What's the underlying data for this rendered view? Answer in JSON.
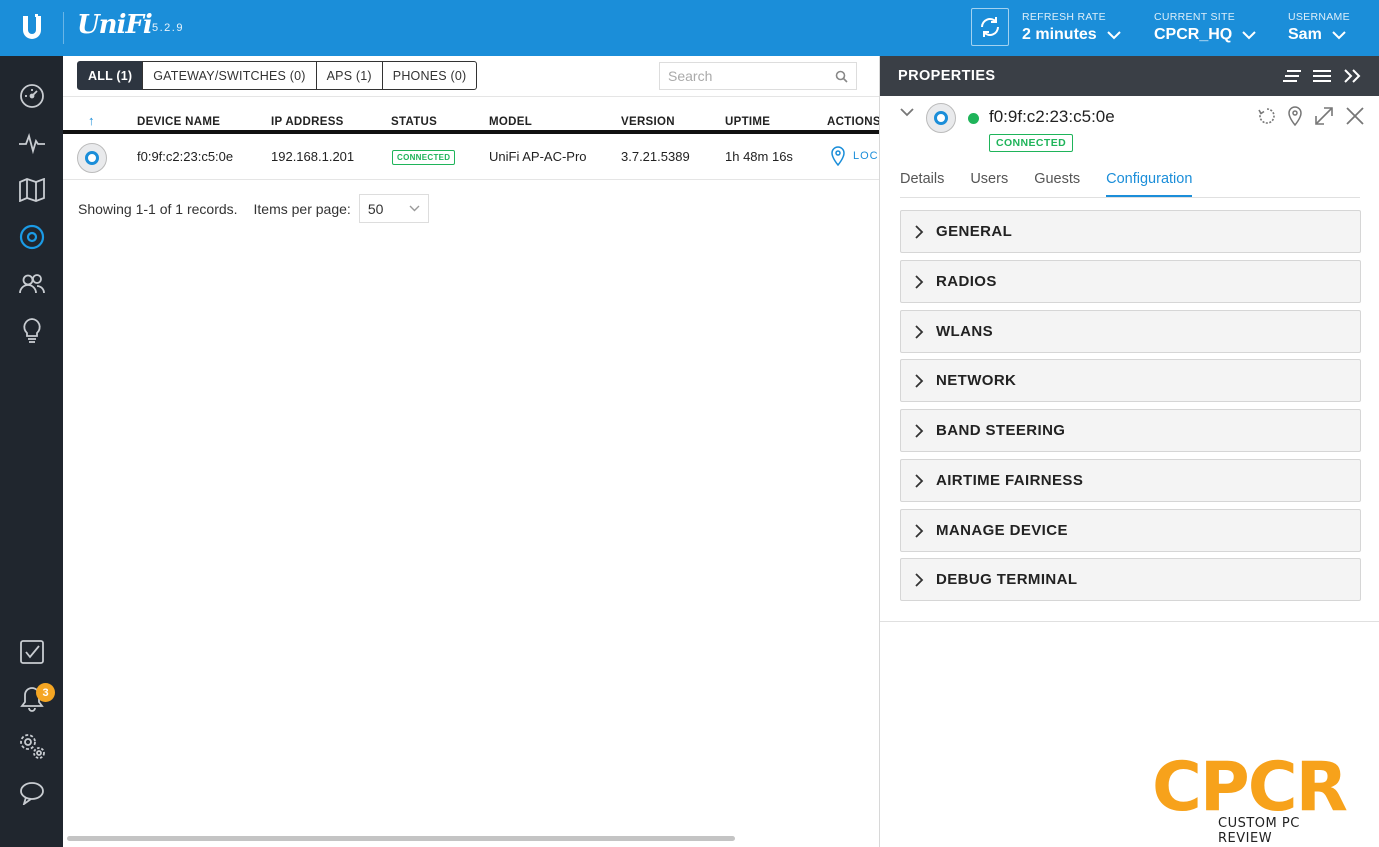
{
  "header": {
    "brand": "UniFi",
    "version": "5.2.9",
    "refresh_rate": {
      "label": "REFRESH RATE",
      "value": "2 minutes"
    },
    "current_site": {
      "label": "CURRENT SITE",
      "value": "CPCR_HQ"
    },
    "username": {
      "label": "USERNAME",
      "value": "Sam"
    }
  },
  "sidebar": {
    "items": [
      {
        "icon": "dashboard-icon"
      },
      {
        "icon": "statistics-icon"
      },
      {
        "icon": "map-icon"
      },
      {
        "icon": "devices-icon",
        "active": true
      },
      {
        "icon": "clients-icon"
      },
      {
        "icon": "insights-icon"
      }
    ],
    "bottom_items": [
      {
        "icon": "events-icon"
      },
      {
        "icon": "alerts-icon",
        "badge": "3"
      },
      {
        "icon": "settings-icon"
      },
      {
        "icon": "chat-icon"
      }
    ]
  },
  "main": {
    "filter_tabs": [
      {
        "label": "ALL (1)",
        "active": true
      },
      {
        "label": "GATEWAY/SWITCHES (0)"
      },
      {
        "label": "APS (1)"
      },
      {
        "label": "PHONES (0)"
      }
    ],
    "search_placeholder": "Search",
    "table": {
      "sort_indicator": "↑",
      "columns": [
        "DEVICE NAME",
        "IP ADDRESS",
        "STATUS",
        "MODEL",
        "VERSION",
        "UPTIME",
        "ACTIONS"
      ],
      "rows": [
        {
          "device_name": "f0:9f:c2:23:c5:0e",
          "ip": "192.168.1.201",
          "status": "CONNECTED",
          "model": "UniFi AP-AC-Pro",
          "version": "3.7.21.5389",
          "uptime": "1h 48m 16s",
          "action": "LOC"
        }
      ]
    },
    "footer": {
      "showing": "Showing 1-1 of 1 records.",
      "items_per_page_label": "Items per page:",
      "items_per_page_value": "50"
    }
  },
  "panel": {
    "title": "PROPERTIES",
    "device_name": "f0:9f:c2:23:c5:0e",
    "device_status": "CONNECTED",
    "tabs": [
      {
        "label": "Details"
      },
      {
        "label": "Users"
      },
      {
        "label": "Guests"
      },
      {
        "label": "Configuration",
        "active": true
      }
    ],
    "sections": [
      "GENERAL",
      "RADIOS",
      "WLANS",
      "NETWORK",
      "BAND STEERING",
      "AIRTIME FAIRNESS",
      "MANAGE DEVICE",
      "DEBUG TERMINAL"
    ]
  },
  "watermark": {
    "big": "CPCR",
    "small": "CUSTOM PC REVIEW"
  },
  "colors": {
    "header_blue": "#1b8ed9",
    "sidebar": "#20262e",
    "connected_green": "#1fb45a",
    "badge_orange": "#f5a623",
    "watermark_orange": "#f7a21b"
  }
}
